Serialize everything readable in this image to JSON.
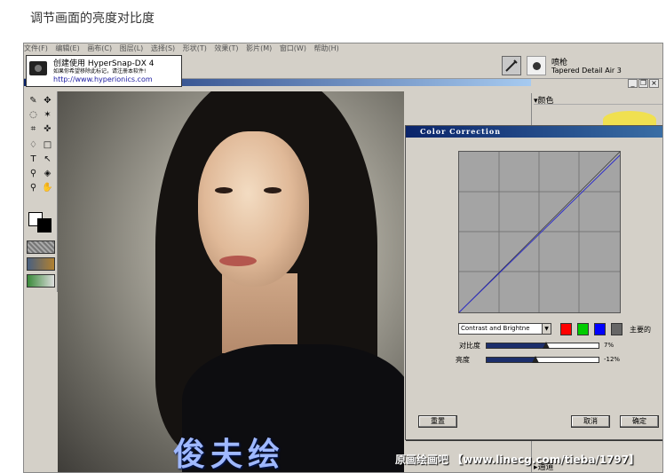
{
  "caption": "调节画面的亮度对比度",
  "menubar": {
    "items": [
      "文件(F)",
      "编辑(E)",
      "画布(C)",
      "图层(L)",
      "选择(S)",
      "形状(T)",
      "效果(T)",
      "影片(M)",
      "窗口(W)",
      "帮助(H)"
    ]
  },
  "hypersnap": {
    "title": "创建使用 HyperSnap-DX 4",
    "subtitle": "如果你希望移除此标记，请注册本软件!",
    "url": "http://www.hyperionics.com"
  },
  "brush": {
    "name": "喷枪",
    "variant": "Tapered Detail Air 3"
  },
  "window_controls": [
    "_",
    "❐",
    "×"
  ],
  "palette": {
    "title": "颜色",
    "bottom_label": "通道"
  },
  "artwork": {
    "signature": "俊夫绘"
  },
  "dialog": {
    "title": "Color Correction",
    "mode": "Contrast and Brightne",
    "channel_label": "主要的",
    "channels": [
      {
        "name": "red",
        "color": "#ff0000"
      },
      {
        "name": "green",
        "color": "#00cc00"
      },
      {
        "name": "blue",
        "color": "#0000ff"
      },
      {
        "name": "master",
        "color": "#666666"
      }
    ],
    "contrast": {
      "label": "对比度",
      "value": "7%",
      "level": 0.53
    },
    "brightness": {
      "label": "亮度",
      "value": "-12%",
      "level": 0.44
    },
    "reset_label": "重置",
    "cancel_label": "取消",
    "ok_label": "确定"
  },
  "watermark": "原画绘画吧 【www.linecg.com/tieba/1797】",
  "colors": {
    "titlebar": "#0a246a",
    "face_light": "#f3dcc2",
    "slider_fill": "#1c2e6b",
    "curve_line": "#3030c8"
  }
}
